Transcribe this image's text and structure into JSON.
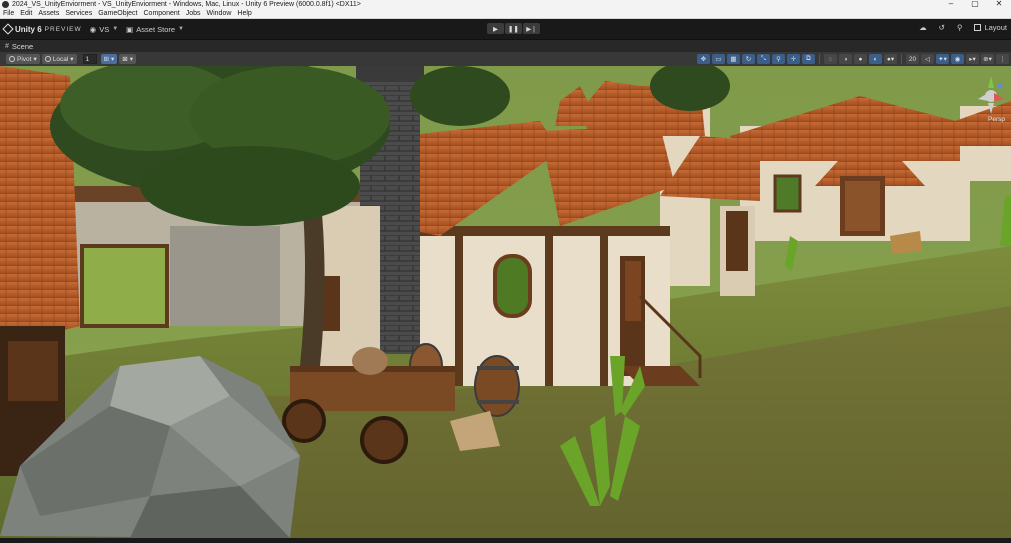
{
  "window": {
    "title": "2024_VS_UnityEnviorment - VS_UnityEnviorment - Windows, Mac, Linux - Unity 6 Preview (6000.0.8f1) <DX11>",
    "controls": {
      "minimize": "–",
      "maximize": "▢",
      "close": "✕"
    }
  },
  "menu": {
    "items": [
      "File",
      "Edit",
      "Assets",
      "Services",
      "GameObject",
      "Component",
      "Jobs",
      "Window",
      "Help"
    ]
  },
  "toolbar": {
    "brand": "Unity 6",
    "brand_suffix": "PREVIEW",
    "account_label": "VS",
    "asset_store_label": "Asset Store",
    "play_icons": [
      "▶",
      "❚❚",
      "▶❘"
    ],
    "layout_label": "Layout"
  },
  "scene_tab": {
    "label": "Scene"
  },
  "scene_toolbar": {
    "pivot_label": "Pivot",
    "space_label": "Local",
    "grid_value": "1",
    "zoom_value": "20",
    "gizmo_label": "Persp"
  },
  "colors": {
    "editor_bg": "#191919",
    "toolbar_bg": "#383838",
    "accent_blue": "#4a6f9e",
    "sky": "#6f8e42",
    "grass": "#7a8a3a",
    "roof": "#b9602e"
  }
}
